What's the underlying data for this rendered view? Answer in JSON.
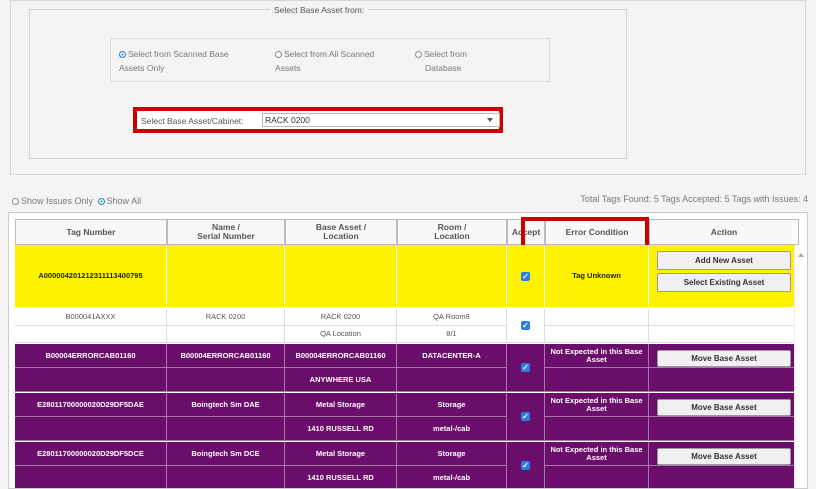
{
  "base_asset_source": {
    "legend": "Select Base Asset from:",
    "options": [
      {
        "line1": "Select from Scanned Base",
        "line2": "Assets Only",
        "selected": true
      },
      {
        "line1": "Select from All Scanned",
        "line2": "Assets",
        "selected": false
      },
      {
        "line1": "Select from",
        "line2": "Database",
        "selected": false
      }
    ]
  },
  "cabinet_select": {
    "label": "Select Base Asset/Cabinet:",
    "value": "RACK 0200"
  },
  "filter": {
    "show_issues_only": "Show Issues Only",
    "show_all": "Show All",
    "selected": "show_all"
  },
  "totals": "Total Tags Found: 5  Tags Accepted: 5  Tags with Issues: 4",
  "columns": [
    {
      "label": "Tag Number"
    },
    {
      "label": "Name /\nSerial Number"
    },
    {
      "label": "Base Asset /\nLocation"
    },
    {
      "label": "Room /\nLocation"
    },
    {
      "label": "Accept"
    },
    {
      "label": "Error Condition"
    },
    {
      "label": "Action"
    }
  ],
  "rows": [
    {
      "style": "yellow",
      "tag": "A0000042012123111134007​95",
      "name": "",
      "base": "",
      "base2": "",
      "room": "",
      "room2": "",
      "accepted": true,
      "error": "Tag Unknown",
      "actions": [
        "Add New Asset",
        "Select Existing Asset"
      ]
    },
    {
      "style": "white",
      "tag": "B000041AXXX",
      "name": "RACK 0200",
      "base": "RACK 0200",
      "base2": "QA Location",
      "room": "QA Room8",
      "room2": "8/1",
      "accepted": true,
      "error": "",
      "actions": []
    },
    {
      "style": "purple",
      "tag": "B00004ERRORCAB01160",
      "name": "B00004ERRORCAB01160",
      "base": "B00004ERRORCAB01160",
      "base2": "ANYWHERE USA",
      "room": "DATACENTER-A",
      "room2": "",
      "accepted": true,
      "error": "Not Expected in this Base Asset",
      "actions": [
        "Move Base Asset"
      ]
    },
    {
      "style": "purple",
      "tag": "E28011700000020D29DF5DAE",
      "name": "Boingtech Sm DAE",
      "base": "Metal Storage",
      "base2": "1410 RUSSELL RD",
      "room": "Storage",
      "room2": "metal-/cab",
      "accepted": true,
      "error": "Not Expected in this Base Asset",
      "actions": [
        "Move Base Asset"
      ]
    },
    {
      "style": "purple",
      "tag": "E28011700000020D29DF5DCE",
      "name": "Boingtech Sm DCE",
      "base": "Metal Storage",
      "base2": "1410 RUSSELL RD",
      "room": "Storage",
      "room2": "metal-/cab",
      "accepted": true,
      "error": "Not Expected in this Base Asset",
      "actions": [
        "Move Base Asset"
      ]
    }
  ],
  "colors": {
    "yellow_row": "#fff200",
    "purple_row": "#6b0d6b",
    "highlight": "#cc0000",
    "checkbox": "#2b7de1"
  }
}
